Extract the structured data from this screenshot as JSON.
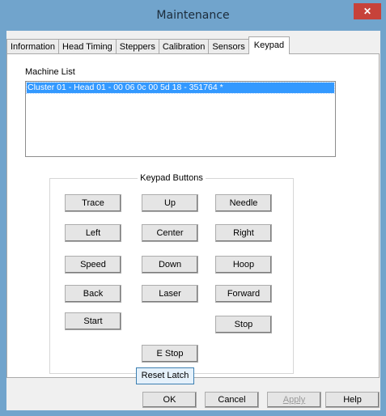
{
  "window": {
    "title": "Maintenance",
    "close_label": "✕"
  },
  "tabs": [
    {
      "label": "Information",
      "active": false
    },
    {
      "label": "Head Timing",
      "active": false
    },
    {
      "label": "Steppers",
      "active": false
    },
    {
      "label": "Calibration",
      "active": false
    },
    {
      "label": "Sensors",
      "active": false
    },
    {
      "label": "Keypad",
      "active": true
    }
  ],
  "machine_list": {
    "label": "Machine List",
    "items": [
      "Cluster 01 - Head 01 - 00 06 0c 00 5d 18 - 351764 *"
    ],
    "selected_index": 0
  },
  "keypad": {
    "title": "Keypad Buttons",
    "buttons": {
      "trace": "Trace",
      "up": "Up",
      "needle": "Needle",
      "left": "Left",
      "center": "Center",
      "right": "Right",
      "speed": "Speed",
      "down": "Down",
      "hoop": "Hoop",
      "back": "Back",
      "laser": "Laser",
      "forward": "Forward",
      "start": "Start",
      "stop": "Stop",
      "estop": "E Stop"
    }
  },
  "reset_latch_label": "Reset Latch",
  "footer": {
    "ok": "OK",
    "cancel": "Cancel",
    "apply": "Apply",
    "help": "Help"
  },
  "colors": {
    "titlebar": "#71a4cc",
    "close": "#c7423a",
    "selection": "#3399ff"
  }
}
